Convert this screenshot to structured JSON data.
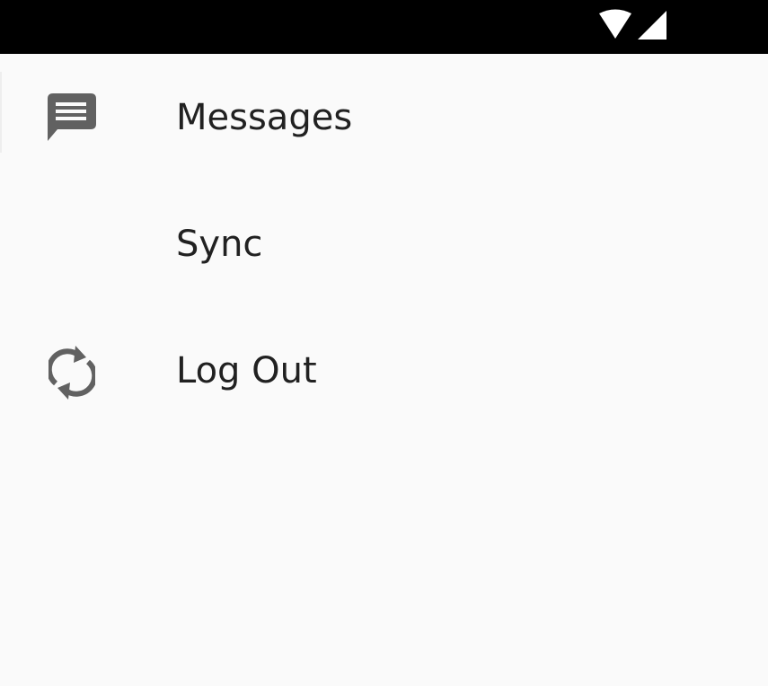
{
  "colors": {
    "status_bar": "#000000",
    "background": "#fafafa",
    "text": "#212121",
    "icon": "#616161"
  },
  "status_bar": {
    "icons": [
      "wifi-icon",
      "cellular-signal-icon"
    ]
  },
  "menu": {
    "items": [
      {
        "label": "Messages",
        "icon": "message-icon"
      },
      {
        "label": "Sync",
        "icon": "sync-icon"
      },
      {
        "label": "Log Out",
        "icon": ""
      }
    ]
  }
}
